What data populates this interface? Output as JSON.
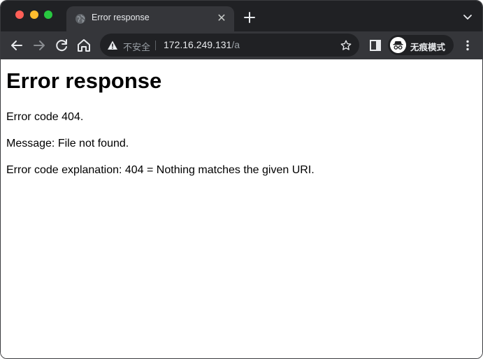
{
  "window": {
    "title_bar": {
      "tab": {
        "title": "Error response",
        "favicon": "globe-icon",
        "close_icon": "close-icon"
      },
      "new_tab_icon": "plus-icon",
      "tab_menu_icon": "chevron-down-icon"
    },
    "toolbar": {
      "back_icon": "arrow-left-icon",
      "forward_icon": "arrow-right-icon",
      "reload_icon": "reload-icon",
      "home_icon": "home-icon",
      "omnibox": {
        "security_icon": "warning-icon",
        "security_label": "不安全",
        "url_host": "172.16.249.131",
        "url_path": "/a",
        "bookmark_icon": "star-icon"
      },
      "side_panel_icon": "side-panel-icon",
      "incognito": {
        "label": "无痕模式",
        "icon": "incognito-icon"
      },
      "menu_icon": "more-vert-icon"
    }
  },
  "page": {
    "heading": "Error response",
    "lines": [
      "Error code 404.",
      "Message: File not found.",
      "Error code explanation: 404 = Nothing matches the given URI."
    ]
  },
  "colors": {
    "tabstrip_bg": "#202124",
    "toolbar_bg": "#35363a",
    "omnibox_bg": "#202124",
    "text_light": "#e8eaed",
    "text_muted": "#9aa0a6"
  }
}
